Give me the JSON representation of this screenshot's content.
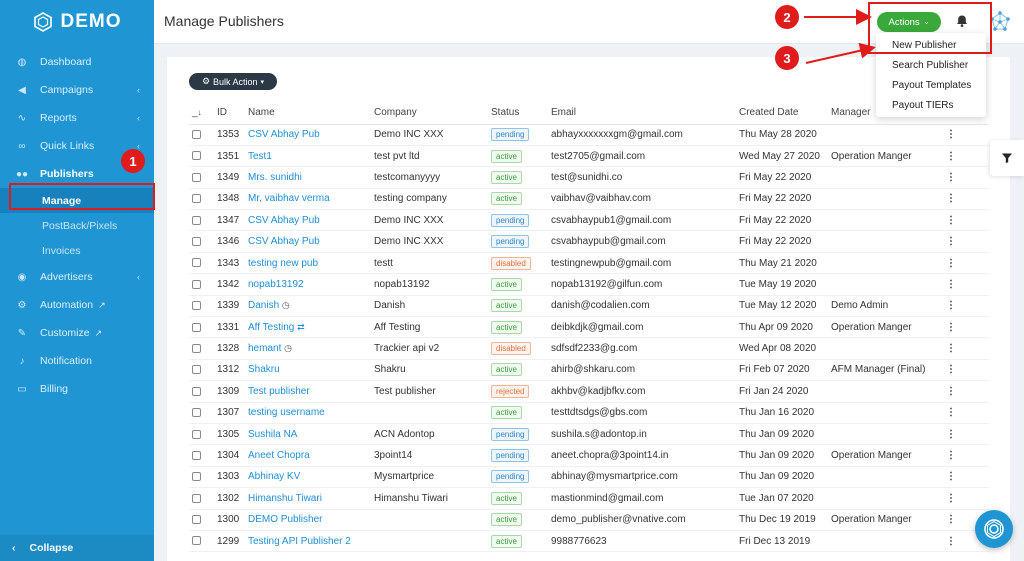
{
  "app": {
    "logo": "DEMO",
    "title": "Manage Publishers"
  },
  "sidebar": {
    "items": [
      {
        "label": "Dashboard",
        "icon": "dashboard-icon",
        "chevron": false
      },
      {
        "label": "Campaigns",
        "icon": "megaphone-icon",
        "chevron": true
      },
      {
        "label": "Reports",
        "icon": "chart-icon",
        "chevron": true
      },
      {
        "label": "Quick Links",
        "icon": "link-icon",
        "chevron": true
      },
      {
        "label": "Publishers",
        "icon": "users-icon",
        "chevron": false
      }
    ],
    "publisher_sub": [
      "Manage",
      "PostBack/Pixels",
      "Invoices"
    ],
    "items_after": [
      {
        "label": "Advertisers",
        "icon": "eye-icon",
        "chevron": true
      },
      {
        "label": "Automation",
        "icon": "cogs-icon",
        "ext": true
      },
      {
        "label": "Customize",
        "icon": "wrench-icon",
        "ext": true
      },
      {
        "label": "Notification",
        "icon": "bell-icon"
      },
      {
        "label": "Billing",
        "icon": "card-icon"
      }
    ],
    "collapse_label": "Collapse"
  },
  "topbar": {
    "actions_label": "Actions"
  },
  "dropdown": [
    "New Publisher",
    "Search Publisher",
    "Payout Templates",
    "Payout TIERs"
  ],
  "toolbar": {
    "bulk_action_label": "Bulk Action"
  },
  "table": {
    "columns": [
      "_",
      "ID",
      "Name",
      "Company",
      "Status",
      "Email",
      "Created Date",
      "Manager"
    ],
    "rows": [
      {
        "id": "1353",
        "name": "CSV Abhay Pub",
        "company": "Demo INC XXX",
        "status": "pending",
        "email": "abhayxxxxxxxgm@gmail.com",
        "created": "Thu May 28 2020",
        "manager": ""
      },
      {
        "id": "1351",
        "name": "Test1",
        "company": "test pvt ltd",
        "status": "active",
        "email": "test2705@gmail.com",
        "created": "Wed May 27 2020",
        "manager": "Operation Manger"
      },
      {
        "id": "1349",
        "name": "Mrs. sunidhi",
        "company": "testcomanyyyy",
        "status": "active",
        "email": "test@sunidhi.co",
        "created": "Fri May 22 2020",
        "manager": ""
      },
      {
        "id": "1348",
        "name": "Mr, vaibhav verma",
        "company": "testing company",
        "status": "active",
        "email": "vaibhav@vaibhav.com",
        "created": "Fri May 22 2020",
        "manager": ""
      },
      {
        "id": "1347",
        "name": "CSV Abhay Pub",
        "company": "Demo INC XXX",
        "status": "pending",
        "email": "csvabhaypub1@gmail.com",
        "created": "Fri May 22 2020",
        "manager": ""
      },
      {
        "id": "1346",
        "name": "CSV Abhay Pub",
        "company": "Demo INC XXX",
        "status": "pending",
        "email": "csvabhaypub@gmail.com",
        "created": "Fri May 22 2020",
        "manager": ""
      },
      {
        "id": "1343",
        "name": "testing new pub",
        "company": "testt",
        "status": "disabled",
        "email": "testingnewpub@gmail.com",
        "created": "Thu May 21 2020",
        "manager": ""
      },
      {
        "id": "1342",
        "name": "nopab13192",
        "company": "nopab13192",
        "status": "active",
        "email": "nopab13192@gilfun.com",
        "created": "Tue May 19 2020",
        "manager": ""
      },
      {
        "id": "1339",
        "name": "Danish",
        "company": "Danish",
        "status": "active",
        "email": "danish@codalien.com",
        "created": "Tue May 12 2020",
        "manager": "Demo Admin",
        "icon": "clock"
      },
      {
        "id": "1331",
        "name": "Aff Testing",
        "company": "Aff Testing",
        "status": "active",
        "email": "deibkdjk@gmail.com",
        "created": "Thu Apr 09 2020",
        "manager": "Operation Manger",
        "icon": "shuffle"
      },
      {
        "id": "1328",
        "name": "hemant",
        "company": "Trackier api v2",
        "status": "disabled",
        "email": "sdfsdf2233@g.com",
        "created": "Wed Apr 08 2020",
        "manager": "",
        "icon": "clock"
      },
      {
        "id": "1312",
        "name": "Shakru",
        "company": "Shakru",
        "status": "active",
        "email": "ahirb@shkaru.com",
        "created": "Fri Feb 07 2020",
        "manager": "AFM Manager (Final)"
      },
      {
        "id": "1309",
        "name": "Test publisher",
        "company": "Test publisher",
        "status": "rejected",
        "email": "akhbv@kadjbfkv.com",
        "created": "Fri Jan 24 2020",
        "manager": ""
      },
      {
        "id": "1307",
        "name": "testing username",
        "company": "",
        "status": "active",
        "email": "testtdtsdgs@gbs.com",
        "created": "Thu Jan 16 2020",
        "manager": ""
      },
      {
        "id": "1305",
        "name": "Sushila NA",
        "company": "ACN Adontop",
        "status": "pending",
        "email": "sushila.s@adontop.in",
        "created": "Thu Jan 09 2020",
        "manager": ""
      },
      {
        "id": "1304",
        "name": "Aneet Chopra",
        "company": "3point14",
        "status": "pending",
        "email": "aneet.chopra@3point14.in",
        "created": "Thu Jan 09 2020",
        "manager": "Operation Manger"
      },
      {
        "id": "1303",
        "name": "Abhinay KV",
        "company": "Mysmartprice",
        "status": "pending",
        "email": "abhinay@mysmartprice.com",
        "created": "Thu Jan 09 2020",
        "manager": ""
      },
      {
        "id": "1302",
        "name": "Himanshu Tiwari",
        "company": "Himanshu Tiwari",
        "status": "active",
        "email": "mastionmind@gmail.com",
        "created": "Tue Jan 07 2020",
        "manager": ""
      },
      {
        "id": "1300",
        "name": "DEMO Publisher",
        "company": "",
        "status": "active",
        "email": "demo_publisher@vnative.com",
        "created": "Thu Dec 19 2019",
        "manager": "Operation Manger"
      },
      {
        "id": "1299",
        "name": "Testing API Publisher 2",
        "company": "",
        "status": "active",
        "email": "9988776623",
        "created": "Fri Dec 13 2019",
        "manager": ""
      }
    ]
  },
  "annotations": {
    "one": "1",
    "two": "2",
    "three": "3"
  },
  "colors": {
    "sidebar": "#1f96d3",
    "accent_green": "#3aa83a",
    "annotation_red": "#e01b1b",
    "link": "#1f8fd6"
  }
}
